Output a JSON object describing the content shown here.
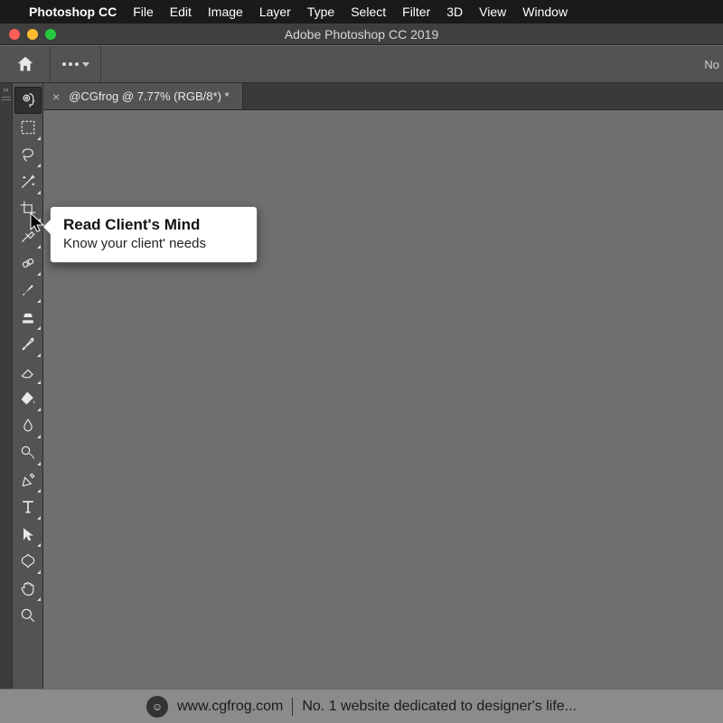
{
  "menubar": {
    "app": "Photoshop CC",
    "items": [
      "File",
      "Edit",
      "Image",
      "Layer",
      "Type",
      "Select",
      "Filter",
      "3D",
      "View",
      "Window"
    ]
  },
  "titlebar": {
    "title": "Adobe Photoshop CC 2019"
  },
  "optionsbar": {
    "right_trunc": "No"
  },
  "doc_tab": {
    "label": "@CGfrog @ 7.77% (RGB/8*) *",
    "close_glyph": "×"
  },
  "tooltip": {
    "title": "Read Client's Mind",
    "desc": "Know your client' needs"
  },
  "tools": [
    {
      "name": "mind-reader-tool",
      "active": true,
      "fly": false
    },
    {
      "name": "marquee-tool",
      "active": false,
      "fly": true
    },
    {
      "name": "lasso-tool",
      "active": false,
      "fly": true
    },
    {
      "name": "magic-wand-tool",
      "active": false,
      "fly": true
    },
    {
      "name": "crop-tool",
      "active": false,
      "fly": true
    },
    {
      "name": "eyedropper-tool",
      "active": false,
      "fly": true
    },
    {
      "name": "healing-brush-tool",
      "active": false,
      "fly": true
    },
    {
      "name": "brush-tool",
      "active": false,
      "fly": true
    },
    {
      "name": "clone-stamp-tool",
      "active": false,
      "fly": true
    },
    {
      "name": "history-brush-tool",
      "active": false,
      "fly": true
    },
    {
      "name": "eraser-tool",
      "active": false,
      "fly": true
    },
    {
      "name": "paint-bucket-tool",
      "active": false,
      "fly": true
    },
    {
      "name": "smudge-tool",
      "active": false,
      "fly": true
    },
    {
      "name": "dodge-tool",
      "active": false,
      "fly": true
    },
    {
      "name": "pen-tool",
      "active": false,
      "fly": true
    },
    {
      "name": "type-tool",
      "active": false,
      "fly": true
    },
    {
      "name": "path-selection-tool",
      "active": false,
      "fly": true
    },
    {
      "name": "custom-shape-tool",
      "active": false,
      "fly": true
    },
    {
      "name": "hand-tool",
      "active": false,
      "fly": true
    },
    {
      "name": "zoom-tool",
      "active": false,
      "fly": false
    }
  ],
  "footer": {
    "site": "www.cgfrog.com",
    "tagline": "No. 1 website dedicated to designer's life..."
  }
}
